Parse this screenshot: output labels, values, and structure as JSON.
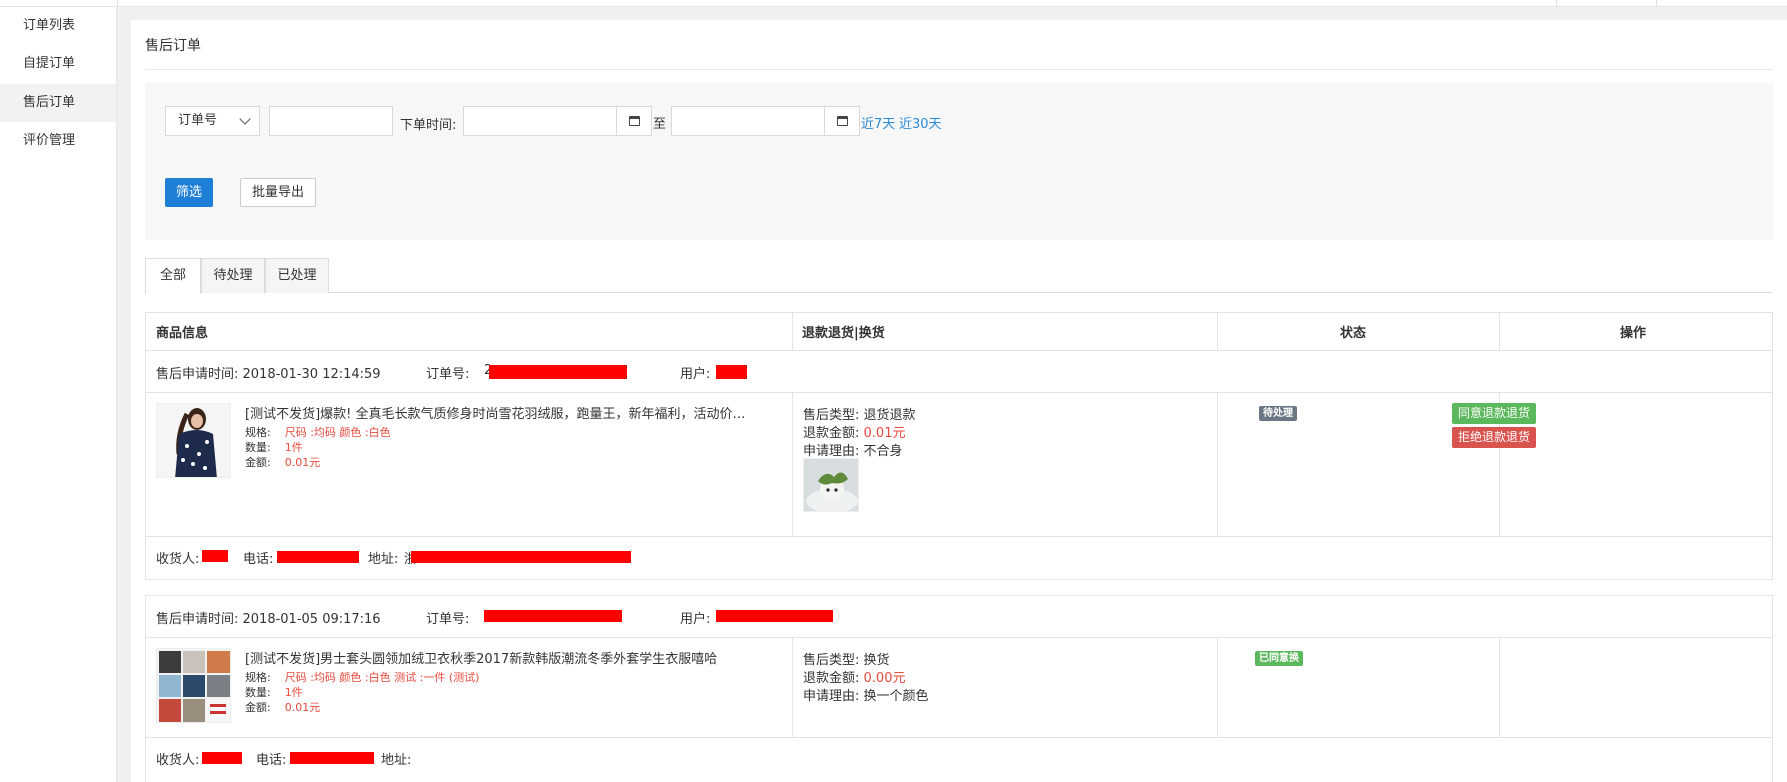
{
  "sidebar": {
    "items": [
      {
        "label": "订单列表"
      },
      {
        "label": "自提订单"
      },
      {
        "label": "售后订单"
      },
      {
        "label": "评价管理"
      }
    ]
  },
  "page": {
    "title": "售后订单"
  },
  "filter": {
    "select_value": "订单号",
    "order_time_label": "下单时间:",
    "to_label": "至",
    "quick_7": "近7天",
    "quick_30": "近30天",
    "filter_button": "筛选",
    "export_button": "批量导出"
  },
  "tabs": [
    {
      "label": "全部"
    },
    {
      "label": "待处理"
    },
    {
      "label": "已处理"
    }
  ],
  "table": {
    "columns": [
      "商品信息",
      "退款退货|换货",
      "状态",
      "操作"
    ]
  },
  "orders": [
    {
      "apply_time": "售后申请时间:  2018-01-30 12:14:59",
      "order_no_label": "订单号:",
      "order_no_prefix": "2",
      "user_label": "用户:",
      "product_name": "[测试不发货]爆款! 全真毛长款气质修身时尚雪花羽绒服，跑量王，新年福利，活动价…",
      "spec_label": "规格:",
      "spec_value": "尺码 :均码     颜色 :白色",
      "qty_label": "数量:",
      "qty_value": "1件",
      "amount_label": "金额:",
      "amount_value": "0.01元",
      "type_label": "售后类型:",
      "type_value": "退货退款",
      "refund_label": "退款金额:",
      "refund_value": "0.01元",
      "reason_label": "申请理由:",
      "reason_value": "不合身",
      "status": "待处理",
      "status_color": "#6b7785",
      "actions": [
        {
          "label": "同意退款退货",
          "color": "#5cb85c"
        },
        {
          "label": "拒绝退款退货",
          "color": "#d9534f"
        }
      ],
      "receiver_label": "收货人:",
      "phone_label": "电话:",
      "address_label": "地址:",
      "address_prefix": "浙"
    },
    {
      "apply_time": "售后申请时间:  2018-01-05 09:17:16",
      "order_no_label": "订单号:",
      "order_no_prefix": "",
      "user_label": "用户:",
      "product_name": "[测试不发货]男士套头圆领加绒卫衣秋季2017新款韩版潮流冬季外套学生衣服嘻哈",
      "spec_label": "规格:",
      "spec_value": "尺码 :均码     颜色 :白色     测试 :一件 (测试)",
      "qty_label": "数量:",
      "qty_value": "1件",
      "amount_label": "金额:",
      "amount_value": "0.01元",
      "type_label": "售后类型:",
      "type_value": "换货",
      "refund_label": "退款金额:",
      "refund_value": "0.00元",
      "reason_label": "申请理由:",
      "reason_value": "换一个颜色",
      "status": "已同意换",
      "status_color": "#5cb85c",
      "receiver_label": "收货人:",
      "phone_label": "电话:",
      "address_label": "地址:"
    }
  ]
}
